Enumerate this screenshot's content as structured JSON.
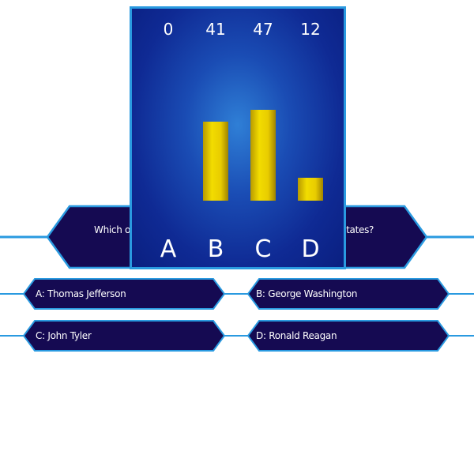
{
  "question": {
    "text_start": "Which of",
    "text_end": "d States?"
  },
  "answers": [
    {
      "key": "A",
      "label": "A: Thomas Jefferson"
    },
    {
      "key": "B",
      "label": "B: George Washington"
    },
    {
      "key": "C",
      "label": "C: John Tyler"
    },
    {
      "key": "D",
      "label": "D: Ronald Reagan"
    }
  ],
  "audience_poll": {
    "letters": [
      "A",
      "B",
      "C",
      "D"
    ],
    "percentages": [
      "0",
      "41",
      "47",
      "12"
    ]
  },
  "chart_data": {
    "type": "bar",
    "categories": [
      "A",
      "B",
      "C",
      "D"
    ],
    "values": [
      0,
      41,
      47,
      12
    ],
    "title": "",
    "xlabel": "",
    "ylabel": ""
  },
  "colors": {
    "hex_fill": "#150a52",
    "hex_border": "#2a9ae0",
    "connector_line": "#2a9ae0",
    "bar_gold": "#f2dc00",
    "panel_blue": "#1a4cb4"
  }
}
